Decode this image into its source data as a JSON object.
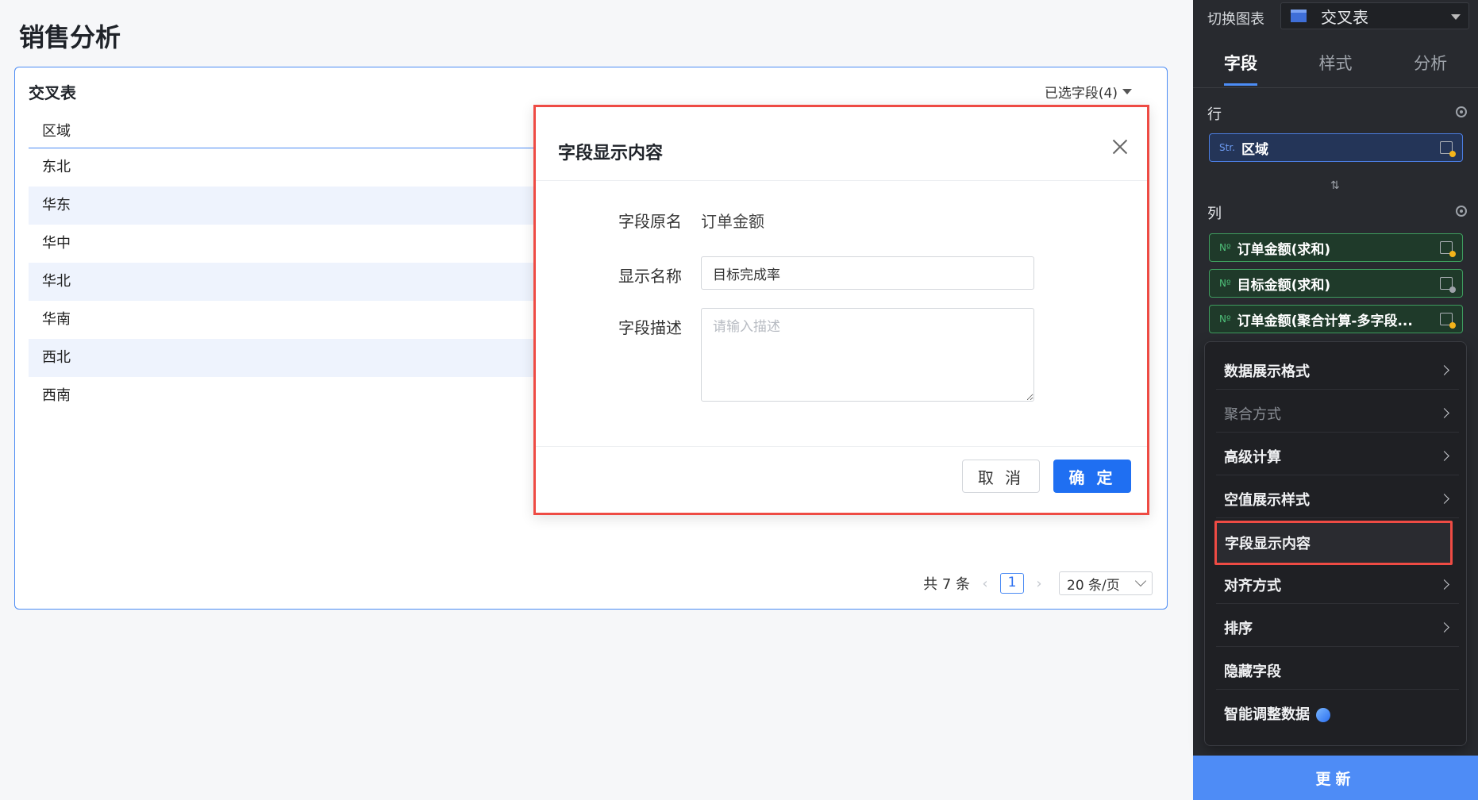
{
  "page": {
    "title": "销售分析"
  },
  "card": {
    "title": "交叉表",
    "selected_fields": "已选字段(4)",
    "table": {
      "header": "区域",
      "rows": [
        "东北",
        "华东",
        "华中",
        "华北",
        "华南",
        "西北",
        "西南"
      ]
    },
    "pager": {
      "total": "共 7 条",
      "current_page": "1",
      "page_size": "20 条/页"
    }
  },
  "dialog": {
    "title": "字段显示内容",
    "orig_name_label": "字段原名",
    "orig_name_value": "订单金额",
    "display_name_label": "显示名称",
    "display_name_value": "目标完成率",
    "desc_label": "字段描述",
    "desc_placeholder": "请输入描述",
    "cancel": "取 消",
    "ok": "确 定"
  },
  "panel": {
    "switch_label": "切换图表",
    "switch_value": "交叉表",
    "tabs": [
      "字段",
      "样式",
      "分析"
    ],
    "rows_title": "行",
    "row_fields": [
      {
        "tag": "Str.",
        "label": "区域"
      }
    ],
    "cols_title": "列",
    "col_fields": [
      {
        "tag": "Nº",
        "label": "订单金额(求和)"
      },
      {
        "tag": "Nº",
        "label": "目标金额(求和)"
      },
      {
        "tag": "Nº",
        "label": "订单金额(聚合计算-多字段..."
      }
    ],
    "menu": [
      {
        "label": "数据展示格式",
        "arrow": true
      },
      {
        "label": "聚合方式",
        "arrow": true,
        "disabled": true
      },
      {
        "label": "高级计算",
        "arrow": true
      },
      {
        "label": "空值展示样式",
        "arrow": true
      },
      {
        "label": "字段显示内容",
        "arrow": false
      },
      {
        "label": "对齐方式",
        "arrow": true
      },
      {
        "label": "排序",
        "arrow": true
      },
      {
        "label": "隐藏字段",
        "arrow": false
      },
      {
        "label": "智能调整数据",
        "arrow": false
      }
    ],
    "update_button": "更新"
  },
  "colors": {
    "accent": "#1f6ff2",
    "highlight_border": "#ee4b44",
    "panel_bg": "#282a2f"
  }
}
